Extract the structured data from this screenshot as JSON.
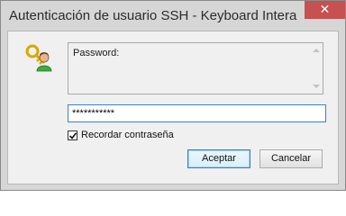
{
  "window": {
    "title": "Autenticación de usuario SSH - Keyboard Intera...",
    "close_glyph": "✕"
  },
  "icons": {
    "key_user": "key-user-icon"
  },
  "prompt": {
    "text": "Password:"
  },
  "password": {
    "value": "***********"
  },
  "remember": {
    "label": "Recordar contraseña",
    "checked": true
  },
  "buttons": {
    "accept": "Aceptar",
    "cancel": "Cancelar"
  },
  "colors": {
    "close_button": "#c75050",
    "focus_border": "#3b7fd1",
    "frame": "#d6d6d6"
  }
}
